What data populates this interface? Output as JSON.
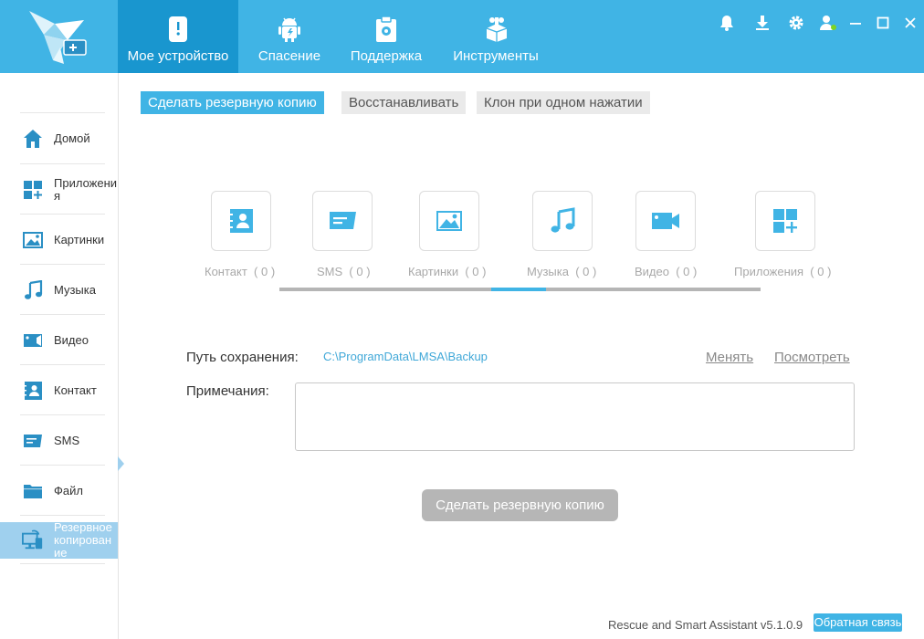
{
  "header": {
    "tabs": [
      {
        "label": "Мое устройство",
        "icon": "phone-icon",
        "active": true
      },
      {
        "label": "Спасение",
        "icon": "android-icon"
      },
      {
        "label": "Поддержка",
        "icon": "clipboard-icon"
      },
      {
        "label": "Инструменты",
        "icon": "toolbox-icon"
      }
    ],
    "window_controls": [
      "bell-icon",
      "download-icon",
      "gear-icon",
      "user-icon",
      "minimize-icon",
      "maximize-icon",
      "close-icon"
    ]
  },
  "sidebar": {
    "items": [
      {
        "label": "Домой",
        "icon": "home-icon"
      },
      {
        "label": "Приложения",
        "icon": "apps-icon"
      },
      {
        "label": "Картинки",
        "icon": "image-icon"
      },
      {
        "label": "Музыка",
        "icon": "music-icon"
      },
      {
        "label": "Видео",
        "icon": "video-icon"
      },
      {
        "label": "Контакт",
        "icon": "contact-icon"
      },
      {
        "label": "SMS",
        "icon": "sms-icon"
      },
      {
        "label": "Файл",
        "icon": "folder-icon"
      },
      {
        "label": "Резервное копирование",
        "icon": "backup-icon",
        "active": true
      }
    ]
  },
  "subtabs": [
    {
      "label": "Сделать резервную копию",
      "active": true
    },
    {
      "label": "Восстанавливать"
    },
    {
      "label": "Клон при одном нажатии"
    }
  ],
  "categories": [
    {
      "label": "Контакт",
      "count": "( 0 )",
      "icon": "contact-icon"
    },
    {
      "label": "SMS",
      "count": "( 0 )",
      "icon": "sms-icon"
    },
    {
      "label": "Картинки",
      "count": "( 0 )",
      "icon": "image-icon"
    },
    {
      "label": "Музыка",
      "count": "( 0 )",
      "icon": "music-icon"
    },
    {
      "label": "Видео",
      "count": "( 0 )",
      "icon": "video-icon"
    },
    {
      "label": "Приложения",
      "count": "( 0 )",
      "icon": "apps-icon"
    }
  ],
  "save_path": {
    "label": "Путь сохранения:",
    "value": "C:\\ProgramData\\LMSA\\Backup",
    "change_label": "Менять",
    "view_label": "Посмотреть"
  },
  "notes": {
    "label": "Примечания:",
    "value": ""
  },
  "backup_button": "Сделать резервную копию",
  "footer": {
    "version": "Rescue and Smart Assistant v5.1.0.9",
    "feedback": "Обратная связь"
  },
  "colors": {
    "accent": "#40b4e5",
    "header_active": "#1996cf",
    "sidebar_active": "#9fd0ee",
    "disabled_button": "#b6b6b6"
  }
}
